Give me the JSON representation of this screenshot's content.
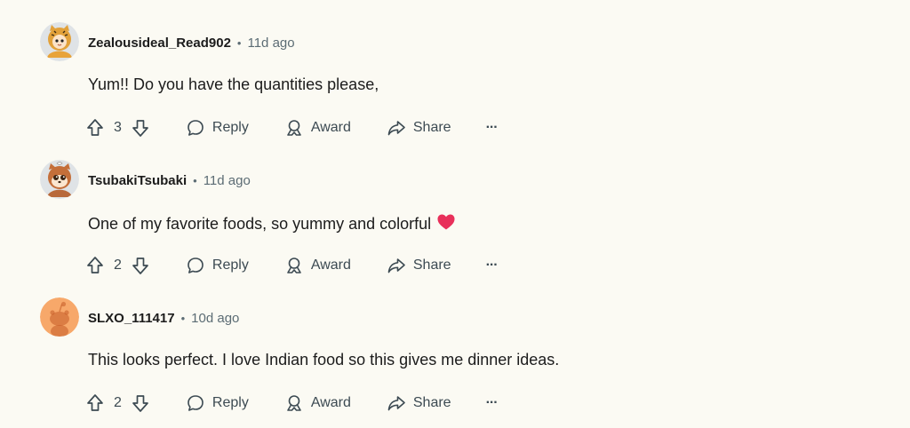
{
  "comments": [
    {
      "username": "Zealousideal_Read902",
      "separator": "•",
      "time": "11d ago",
      "text": "Yum!! Do you have the quantities please,",
      "votes": "3",
      "reply_label": "Reply",
      "award_label": "Award",
      "share_label": "Share",
      "more_label": "···",
      "avatar": "cat-costume-avatar"
    },
    {
      "username": "TsubakiTsubaki",
      "separator": "•",
      "time": "11d ago",
      "text": "One of my favorite foods, so yummy and colorful",
      "emoji": "heart",
      "votes": "2",
      "reply_label": "Reply",
      "award_label": "Award",
      "share_label": "Share",
      "more_label": "···",
      "avatar": "tanuki-avatar"
    },
    {
      "username": "SLXO_111417",
      "separator": "•",
      "time": "10d ago",
      "text": "This looks perfect. I love Indian food so this gives me dinner ideas.",
      "votes": "2",
      "reply_label": "Reply",
      "award_label": "Award",
      "share_label": "Share",
      "more_label": "···",
      "avatar": "default-snoo-avatar"
    }
  ],
  "colors": {
    "background": "#fbfaf3",
    "text": "#1c1c1c",
    "meta": "#5c6c74",
    "action": "#3c4a52",
    "heart": "#e8305a",
    "default_avatar": "#f7a86a"
  }
}
